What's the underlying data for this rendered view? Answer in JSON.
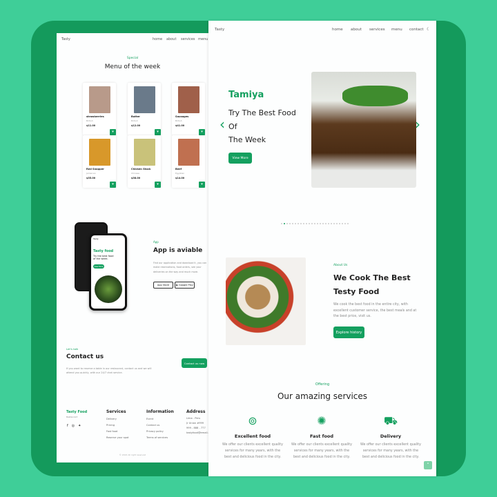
{
  "colors": {
    "accent": "#14a05f",
    "background": "#3fce98",
    "frame": "#149a5c"
  },
  "left": {
    "nav": {
      "brand": "Tasty",
      "items": [
        "home",
        "about",
        "services",
        "menu"
      ],
      "active": "menu"
    },
    "menu": {
      "eyebrow": "Special",
      "title": "Menu of the week",
      "items": [
        {
          "name": "strawberries",
          "origin": "British",
          "price": "$11.00"
        },
        {
          "name": "Butter",
          "origin": "British",
          "price": "$12.00"
        },
        {
          "name": "Sausages",
          "origin": "British",
          "price": "$41.00"
        },
        {
          "name": "Red Snapper",
          "origin": "Jamaican",
          "price": "$35.00"
        },
        {
          "name": "Chicken Stock",
          "origin": "Chinese",
          "price": "$38.00"
        },
        {
          "name": "Beef",
          "origin": "Egyptian",
          "price": "$14.00"
        }
      ],
      "cart_icon": "cart-icon"
    },
    "app": {
      "eyebrow": "App",
      "title": "App is aviable",
      "text": "Find our application and download it, you can make reservations, food orders, see your deliveries on the way and much more.",
      "app_store": "App Store",
      "google_play": "Google Play",
      "phone": {
        "brand": "Tasty",
        "title": "Tasty food",
        "text": "Try the best food of the week.",
        "button": "View More"
      }
    },
    "contact": {
      "eyebrow": "Let's talk",
      "title": "Contact us",
      "text": "If you want to reserve a table in our restaurant, contact us and we will attend you quickly, with our 24/7 chat service.",
      "button": "Contact us now"
    },
    "footer": {
      "brand": "Tasty Food",
      "sub": "Restaurant",
      "socials": [
        "facebook-icon",
        "instagram-icon",
        "twitter-icon"
      ],
      "services": {
        "title": "Services",
        "items": [
          "Delivery",
          "Pricing",
          "Fast food",
          "Reserve your spot"
        ]
      },
      "information": {
        "title": "Information",
        "items": [
          "Event",
          "Contact us",
          "Privacy policy",
          "Terms of services"
        ]
      },
      "address": {
        "title": "Address",
        "items": [
          "Lima - Peru",
          "Jr Union #999",
          "999 - 888 - 777",
          "tastyfood@email.com"
        ]
      },
      "copyright": "© 2022 All right reserved"
    }
  },
  "right": {
    "nav": {
      "brand": "Tasty",
      "items": [
        "home",
        "about",
        "services",
        "menu",
        "contact"
      ],
      "active": "home",
      "theme_icon": "moon-icon"
    },
    "hero": {
      "name": "Tamiya",
      "line1": "Try The Best Food",
      "line2": "Of",
      "line3": "The Week",
      "button": "View More",
      "slide_count": 25,
      "active_slide": 2
    },
    "about": {
      "eyebrow": "About Us",
      "title1": "We Cook The Best",
      "title2": "Testy Food",
      "text": "We cook the best food in the entire city, with excellent customer service, the best meals and at the best price, visit us.",
      "button": "Explore history"
    },
    "services": {
      "eyebrow": "Offering",
      "title": "Our amazing services",
      "items": [
        {
          "title": "Excellent food",
          "icon": "plate-cutlery-icon",
          "text": "We offer our clients excellent quality services for many years, with the best and delicious food in the city."
        },
        {
          "title": "Fast food",
          "icon": "pizza-icon",
          "text": "We offer our clients excellent quality services for many years, with the best and delicious food in the city."
        },
        {
          "title": "Delivery",
          "icon": "delivery-truck-icon",
          "text": "We offer our clients excellent quality services for many years, with the best and delicious food in the city."
        }
      ]
    },
    "scroll_top_icon": "chevron-up-icon"
  }
}
